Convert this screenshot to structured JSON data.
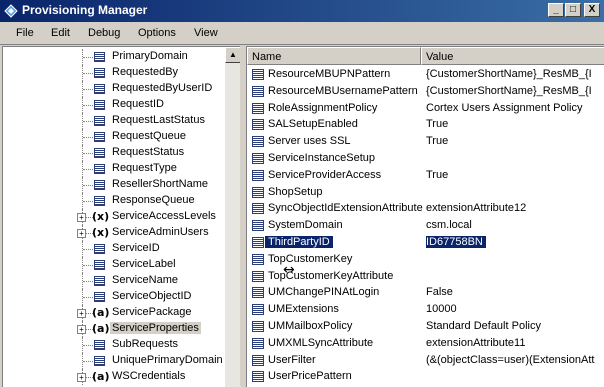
{
  "window": {
    "title": "Provisioning Manager",
    "controls": [
      "_",
      "□",
      "X"
    ]
  },
  "menu": [
    "File",
    "Edit",
    "Debug",
    "Options",
    "View"
  ],
  "tree": {
    "items": [
      {
        "label": "PrimaryDomain",
        "icon": "list-icon",
        "expand": ""
      },
      {
        "label": "RequestedBy",
        "icon": "list-icon",
        "expand": ""
      },
      {
        "label": "RequestedByUserID",
        "icon": "list-icon",
        "expand": ""
      },
      {
        "label": "RequestID",
        "icon": "list-icon",
        "expand": ""
      },
      {
        "label": "RequestLastStatus",
        "icon": "list-icon",
        "expand": ""
      },
      {
        "label": "RequestQueue",
        "icon": "list-icon",
        "expand": ""
      },
      {
        "label": "RequestStatus",
        "icon": "list-icon",
        "expand": ""
      },
      {
        "label": "RequestType",
        "icon": "list-icon",
        "expand": ""
      },
      {
        "label": "ResellerShortName",
        "icon": "list-icon",
        "expand": ""
      },
      {
        "label": "ResponseQueue",
        "icon": "list-icon",
        "expand": ""
      },
      {
        "label": "ServiceAccessLevels",
        "icon": "x-icon",
        "expand": "+"
      },
      {
        "label": "ServiceAdminUsers",
        "icon": "x-icon",
        "expand": "+"
      },
      {
        "label": "ServiceID",
        "icon": "list-icon",
        "expand": ""
      },
      {
        "label": "ServiceLabel",
        "icon": "list-icon",
        "expand": ""
      },
      {
        "label": "ServiceName",
        "icon": "list-icon",
        "expand": ""
      },
      {
        "label": "ServiceObjectID",
        "icon": "list-icon",
        "expand": ""
      },
      {
        "label": "ServicePackage",
        "icon": "a-icon",
        "expand": "+"
      },
      {
        "label": "ServiceProperties",
        "icon": "a-icon",
        "expand": "+",
        "selected": true
      },
      {
        "label": "SubRequests",
        "icon": "list-icon",
        "expand": ""
      },
      {
        "label": "UniquePrimaryDomain",
        "icon": "list-icon",
        "expand": ""
      },
      {
        "label": "WSCredentials",
        "icon": "a-icon",
        "expand": "+"
      }
    ]
  },
  "grid": {
    "columns": {
      "name": "Name",
      "value": "Value"
    },
    "rows": [
      {
        "name": "ResourceMBUPNPattern",
        "value": "{CustomerShortName}_ResMB_{I"
      },
      {
        "name": "ResourceMBUsernamePattern",
        "value": "{CustomerShortName}_ResMB_{I"
      },
      {
        "name": "RoleAssignmentPolicy",
        "value": "Cortex Users Assignment Policy"
      },
      {
        "name": "SALSetupEnabled",
        "value": "True"
      },
      {
        "name": "Server uses SSL",
        "value": "True"
      },
      {
        "name": "ServiceInstanceSetup",
        "value": ""
      },
      {
        "name": "ServiceProviderAccess",
        "value": "True"
      },
      {
        "name": "ShopSetup",
        "value": ""
      },
      {
        "name": "SyncObjectIdExtensionAttribute",
        "value": "extensionAttribute12"
      },
      {
        "name": "SystemDomain",
        "value": "csm.local"
      },
      {
        "name": "ThirdPartyID",
        "value": "ID67758BN",
        "selected": true
      },
      {
        "name": "TopCustomerKey",
        "value": ""
      },
      {
        "name": "TopCustomerKeyAttribute",
        "value": ""
      },
      {
        "name": "UMChangePINAtLogin",
        "value": "False"
      },
      {
        "name": "UMExtensions",
        "value": "10000"
      },
      {
        "name": "UMMailboxPolicy",
        "value": "Standard Default Policy"
      },
      {
        "name": "UMXMLSyncAttribute",
        "value": "extensionAttribute11"
      },
      {
        "name": "UserFilter",
        "value": "(&(objectClass=user)(ExtensionAtt"
      },
      {
        "name": "UserPricePattern",
        "value": ""
      }
    ]
  },
  "colors": {
    "titlebar_start": "#0a246a",
    "titlebar_end": "#3a6ea5",
    "selection": "#0a246a"
  }
}
